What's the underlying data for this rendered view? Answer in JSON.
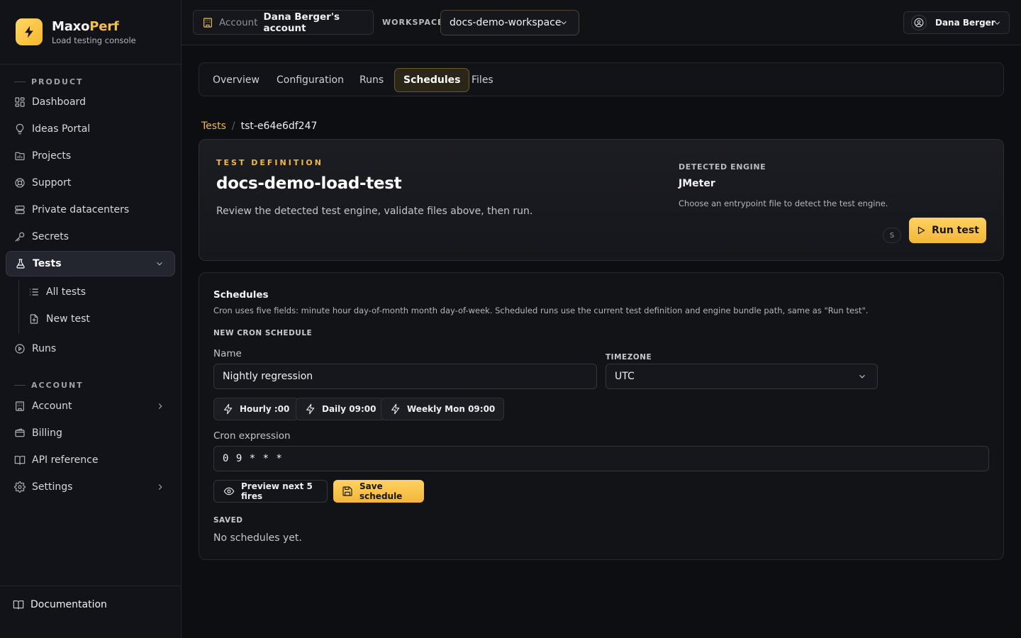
{
  "brand": {
    "name_main": "Maxo",
    "name_accent": "Perf",
    "subtitle": "Load testing console"
  },
  "sidebar": {
    "product_label": "PRODUCT",
    "product_items": [
      {
        "label": "Dashboard",
        "icon": "dashboard-icon"
      },
      {
        "label": "Ideas Portal",
        "icon": "lightbulb-icon"
      },
      {
        "label": "Projects",
        "icon": "folder-chart-icon"
      },
      {
        "label": "Support",
        "icon": "lifebuoy-icon"
      },
      {
        "label": "Private datacenters",
        "icon": "server-icon"
      },
      {
        "label": "Secrets",
        "icon": "key-icon"
      },
      {
        "label": "Tests",
        "icon": "flask-icon",
        "active": true,
        "expanded": true
      },
      {
        "label": "Runs",
        "icon": "play-circle-icon"
      }
    ],
    "tests_subitems": [
      {
        "label": "All tests",
        "icon": "list-icon"
      },
      {
        "label": "New test",
        "icon": "file-plus-icon"
      }
    ],
    "account_label": "ACCOUNT",
    "account_items": [
      {
        "label": "Account",
        "icon": "building-icon",
        "has_chevron": true
      },
      {
        "label": "Billing",
        "icon": "wallet-icon"
      },
      {
        "label": "API reference",
        "icon": "book-open-icon"
      },
      {
        "label": "Settings",
        "icon": "gear-icon",
        "has_chevron": true
      }
    ],
    "footer_link": "Documentation"
  },
  "topbar": {
    "account_label": "Account",
    "account_value": "Dana Berger's account",
    "workspace_label": "WORKSPACE",
    "workspace_value": "docs-demo-workspace",
    "user_name": "Dana Berger"
  },
  "tabs": [
    {
      "label": "Overview"
    },
    {
      "label": "Configuration"
    },
    {
      "label": "Runs"
    },
    {
      "label": "Schedules",
      "active": true
    },
    {
      "label": "Files"
    }
  ],
  "breadcrumb": {
    "root": "Tests",
    "separator": "/",
    "current": "tst-e64e6df247"
  },
  "definition": {
    "kicker": "TEST DEFINITION",
    "title": "docs-demo-load-test",
    "description": "Review the detected test engine, validate files above, then run.",
    "engine_label": "DETECTED ENGINE",
    "engine_value": "JMeter",
    "engine_hint": "Choose an entrypoint file to detect the test engine.",
    "badge": "S",
    "run_label": "Run test"
  },
  "schedules": {
    "title": "Schedules",
    "description": "Cron uses five fields: minute hour day-of-month month day-of-week. Scheduled runs use the current test definition and engine bundle path, same as \"Run test\".",
    "new_label": "NEW CRON SCHEDULE",
    "name_label": "Name",
    "name_value": "Nightly regression",
    "timezone_label": "TIMEZONE",
    "timezone_value": "UTC",
    "presets": [
      "Hourly :00",
      "Daily 09:00",
      "Weekly Mon 09:00"
    ],
    "cron_label": "Cron expression",
    "cron_value": "0 9 * * *",
    "preview_label": "Preview next 5 fires",
    "save_label": "Save schedule",
    "saved_label": "SAVED",
    "empty_text": "No schedules yet."
  }
}
